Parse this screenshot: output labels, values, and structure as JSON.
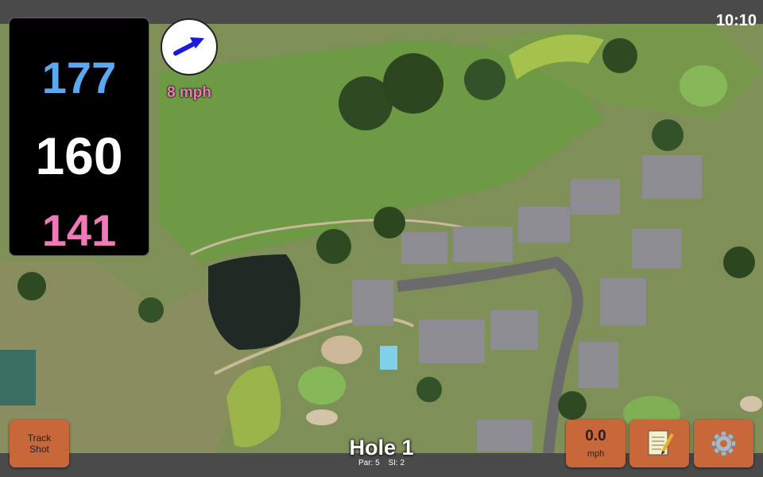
{
  "status": {
    "time": "10:10"
  },
  "distances": {
    "back": "177",
    "center": "160",
    "front": "141",
    "colors": {
      "back": "#5aa9f0",
      "center": "#ffffff",
      "front": "#f07ab8"
    }
  },
  "wind": {
    "speed_label": "8 mph",
    "direction_icon": "arrow-right-icon",
    "arrow_color": "#1a1ad8",
    "label_color": "#f07ab8"
  },
  "buttons": {
    "track_shot_line1": "Track",
    "track_shot_line2": "Shot",
    "wind_value": "0.0",
    "wind_unit": "mph",
    "notes_icon": "notepad-icon",
    "settings_icon": "gear-icon",
    "accent": "#c8683a"
  },
  "hole": {
    "title": "Hole 1",
    "par": "Par: 5",
    "si": "SI: 2"
  },
  "map": {
    "type": "satellite-aerial-view"
  }
}
